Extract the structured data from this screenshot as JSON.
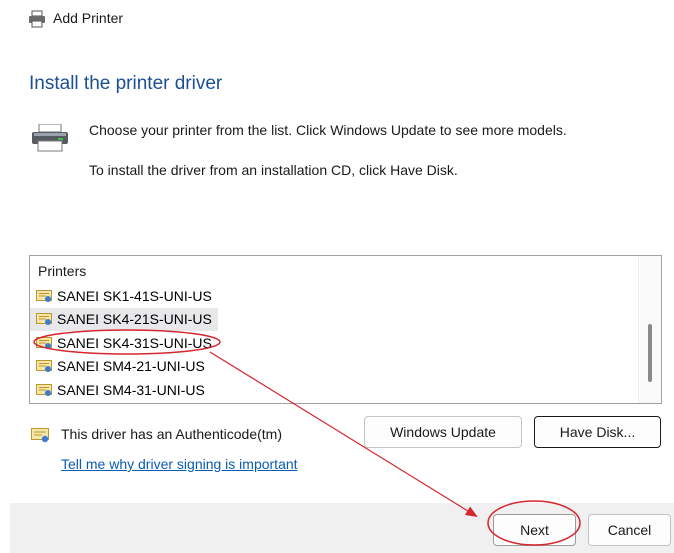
{
  "window": {
    "title": "Add Printer",
    "title_icon": "printer-icon"
  },
  "heading": "Install the printer driver",
  "instructions": {
    "line1": "Choose your printer from the list. Click Windows Update to see more models.",
    "line2": "To install the driver from an installation CD, click Have Disk."
  },
  "printers_list": {
    "header": "Printers",
    "items": [
      {
        "label": "SANEI SK1-41S-UNI-US",
        "icon": "certificate-icon"
      },
      {
        "label": "SANEI SK4-21S-UNI-US",
        "icon": "certificate-icon",
        "selected": true
      },
      {
        "label": "SANEI SK4-31S-UNI-US",
        "icon": "certificate-icon"
      },
      {
        "label": "SANEI SM4-21-UNI-US",
        "icon": "certificate-icon"
      },
      {
        "label": "SANEI SM4-31-UNI-US",
        "icon": "certificate-icon"
      }
    ]
  },
  "buttons": {
    "windows_update": "Windows Update",
    "have_disk": "Have Disk...",
    "next": "Next",
    "cancel": "Cancel"
  },
  "signing": {
    "status": "This driver has an Authenticode(tm)",
    "link": "Tell me why driver signing is important"
  },
  "colors": {
    "heading": "#1c4f93",
    "link": "#0a5bb5",
    "annotation": "#d6262e",
    "footer": "#f0f0f0"
  }
}
